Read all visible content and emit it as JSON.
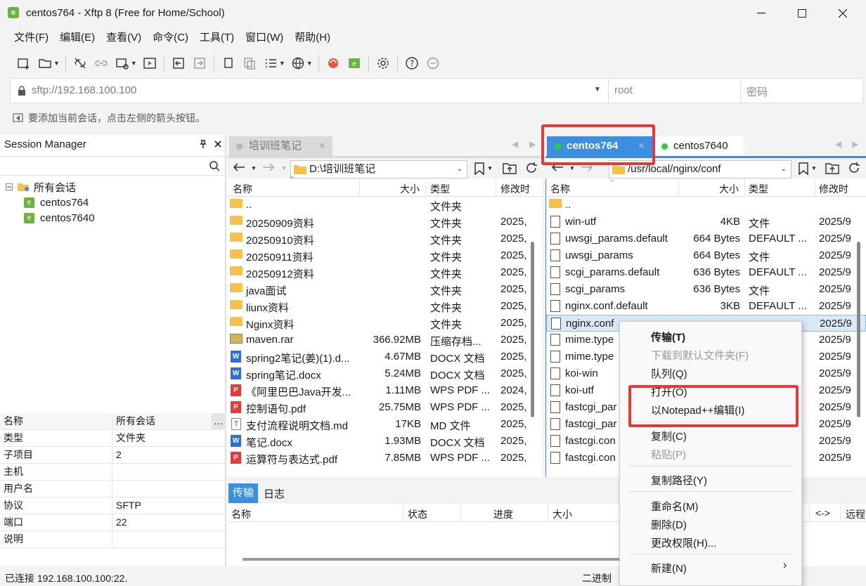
{
  "window": {
    "title": "centos764 - Xftp 8 (Free for Home/School)",
    "app_icon": "xftp-icon"
  },
  "menu": [
    "文件(F)",
    "编辑(E)",
    "查看(V)",
    "命令(C)",
    "工具(T)",
    "窗口(W)",
    "帮助(H)"
  ],
  "address": {
    "url": "sftp://192.168.100.100",
    "user_placeholder": "root",
    "password_placeholder": "密码"
  },
  "hint": "要添加当前会话，点击左侧的箭头按钮。",
  "session_manager": {
    "title": "Session Manager",
    "tree_root": "所有会话",
    "sessions": [
      "centos764",
      "centos7640"
    ],
    "props_header": {
      "k": "名称",
      "v": "所有会话"
    },
    "props": [
      {
        "k": "类型",
        "v": "文件夹"
      },
      {
        "k": "子项目",
        "v": "2"
      },
      {
        "k": "主机",
        "v": ""
      },
      {
        "k": "用户名",
        "v": ""
      },
      {
        "k": "协议",
        "v": "SFTP"
      },
      {
        "k": "端口",
        "v": "22"
      },
      {
        "k": "说明",
        "v": ""
      }
    ]
  },
  "left_pane": {
    "tab": "培训班笔记",
    "path": "D:\\培训班笔记",
    "columns": [
      "名称",
      "大小",
      "类型",
      "修改时"
    ],
    "files": [
      {
        "icon": "folder",
        "name": "..",
        "size": "",
        "type": "文件夹",
        "date": ""
      },
      {
        "icon": "folder",
        "name": "20250909资料",
        "size": "",
        "type": "文件夹",
        "date": "2025,"
      },
      {
        "icon": "folder",
        "name": "20250910资料",
        "size": "",
        "type": "文件夹",
        "date": "2025,"
      },
      {
        "icon": "folder",
        "name": "20250911资料",
        "size": "",
        "type": "文件夹",
        "date": "2025,"
      },
      {
        "icon": "folder",
        "name": "20250912资料",
        "size": "",
        "type": "文件夹",
        "date": "2025,"
      },
      {
        "icon": "folder",
        "name": "java面试",
        "size": "",
        "type": "文件夹",
        "date": "2025,"
      },
      {
        "icon": "folder",
        "name": "liunx资料",
        "size": "",
        "type": "文件夹",
        "date": "2025,"
      },
      {
        "icon": "folder",
        "name": "Nginx资料",
        "size": "",
        "type": "文件夹",
        "date": "2025,"
      },
      {
        "icon": "rar",
        "name": "maven.rar",
        "size": "366.92MB",
        "type": "压缩存档...",
        "date": "2025,"
      },
      {
        "icon": "word",
        "name": "spring2笔记(姜)(1).d...",
        "size": "4.67MB",
        "type": "DOCX 文档",
        "date": "2025,"
      },
      {
        "icon": "word",
        "name": "spring笔记.docx",
        "size": "5.24MB",
        "type": "DOCX 文档",
        "date": "2025,"
      },
      {
        "icon": "pdf",
        "name": "《阿里巴巴Java开发...",
        "size": "1.11MB",
        "type": "WPS PDF ...",
        "date": "2024,"
      },
      {
        "icon": "pdf",
        "name": "控制语句.pdf",
        "size": "25.75MB",
        "type": "WPS PDF ...",
        "date": "2025,"
      },
      {
        "icon": "md",
        "name": "支付流程说明文档.md",
        "size": "17KB",
        "type": "MD 文件",
        "date": "2025,"
      },
      {
        "icon": "word",
        "name": "笔记.docx",
        "size": "1.93MB",
        "type": "DOCX 文档",
        "date": "2025,"
      },
      {
        "icon": "pdf",
        "name": "运算符与表达式.pdf",
        "size": "7.85MB",
        "type": "WPS PDF ...",
        "date": "2025,"
      }
    ]
  },
  "right_pane": {
    "tabs": [
      "centos764",
      "centos7640"
    ],
    "path": "/usr/local/nginx/conf",
    "columns": [
      "名称",
      "大小",
      "类型",
      "修改时"
    ],
    "files": [
      {
        "icon": "folder",
        "name": "..",
        "size": "",
        "type": "",
        "date": ""
      },
      {
        "icon": "file",
        "name": "win-utf",
        "size": "4KB",
        "type": "文件",
        "date": "2025/9"
      },
      {
        "icon": "file",
        "name": "uwsgi_params.default",
        "size": "664 Bytes",
        "type": "DEFAULT ...",
        "date": "2025/9"
      },
      {
        "icon": "file",
        "name": "uwsgi_params",
        "size": "664 Bytes",
        "type": "文件",
        "date": "2025/9"
      },
      {
        "icon": "file",
        "name": "scgi_params.default",
        "size": "636 Bytes",
        "type": "DEFAULT ...",
        "date": "2025/9"
      },
      {
        "icon": "file",
        "name": "scgi_params",
        "size": "636 Bytes",
        "type": "文件",
        "date": "2025/9"
      },
      {
        "icon": "file",
        "name": "nginx.conf.default",
        "size": "3KB",
        "type": "DEFAULT ...",
        "date": "2025/9"
      },
      {
        "icon": "file",
        "name": "nginx.conf",
        "size": "",
        "type": "",
        "date": "2025/9"
      },
      {
        "icon": "file",
        "name": "mime.type",
        "size": "",
        "type": "",
        "date": "2025/9"
      },
      {
        "icon": "file",
        "name": "mime.type",
        "size": "",
        "type": "",
        "date": "2025/9"
      },
      {
        "icon": "file",
        "name": "koi-win",
        "size": "",
        "type": "",
        "date": "2025/9"
      },
      {
        "icon": "file",
        "name": "koi-utf",
        "size": "",
        "type": "",
        "date": "2025/9"
      },
      {
        "icon": "file",
        "name": "fastcgi_par",
        "size": "",
        "type": "",
        "date": "2025/9"
      },
      {
        "icon": "file",
        "name": "fastcgi_par",
        "size": "",
        "type": "",
        "date": "2025/9"
      },
      {
        "icon": "file",
        "name": "fastcgi.con",
        "size": "",
        "type": "",
        "date": "2025/9"
      },
      {
        "icon": "file",
        "name": "fastcgi.con",
        "size": "",
        "type": "",
        "date": "2025/9"
      }
    ]
  },
  "transfer": {
    "tabs": [
      "传输",
      "日志"
    ],
    "columns": [
      "名称",
      "状态",
      "进度",
      "大小",
      "<->",
      "远程"
    ]
  },
  "context_menu": [
    {
      "label": "传输(T)",
      "bold": true,
      "disabled": false
    },
    {
      "label": "下载到默认文件夹(F)",
      "disabled": true
    },
    {
      "label": "队列(Q)",
      "disabled": false
    },
    {
      "label": "打开(O)",
      "disabled": false
    },
    {
      "label": "以Notepad++编辑(I)",
      "disabled": false
    },
    {
      "label": "复制(C)",
      "disabled": false
    },
    {
      "label": "粘贴(P)",
      "disabled": true
    },
    {
      "label": "复制路径(Y)",
      "disabled": false
    },
    {
      "label": "重命名(M)",
      "disabled": false
    },
    {
      "label": "删除(D)",
      "disabled": false
    },
    {
      "label": "更改权限(H)...",
      "disabled": false
    },
    {
      "label": "新建(N)",
      "disabled": false
    }
  ],
  "status": {
    "connected": "已连接 192.168.100.100:22.",
    "mode": "二进制"
  },
  "colors": {
    "accent": "#3c8fde",
    "highlight_red": "#e53935",
    "session_green": "#2ecc40"
  }
}
